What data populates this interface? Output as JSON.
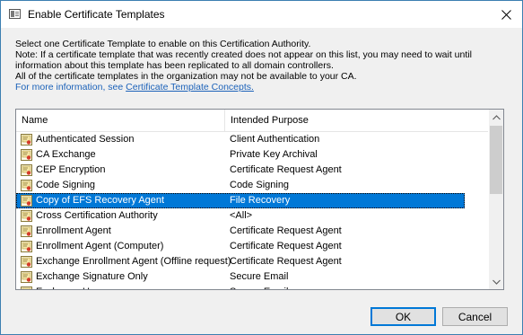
{
  "window": {
    "title": "Enable Certificate Templates"
  },
  "description": {
    "line1": "Select one Certificate Template to enable on this Certification Authority.",
    "line2": "Note: If a certificate template that was recently created does not appear on this list, you may need to wait until",
    "line3": "information about this template has been replicated to all domain controllers.",
    "line4": "All of the certificate templates in the organization may not be available to your CA.",
    "info_prefix": "For more information, see ",
    "info_link": "Certificate Template Concepts."
  },
  "list": {
    "columns": {
      "name": "Name",
      "purpose": "Intended Purpose"
    },
    "rows": [
      {
        "name": "Authenticated Session",
        "purpose": "Client Authentication",
        "selected": false
      },
      {
        "name": "CA Exchange",
        "purpose": "Private Key Archival",
        "selected": false
      },
      {
        "name": "CEP Encryption",
        "purpose": "Certificate Request Agent",
        "selected": false
      },
      {
        "name": "Code Signing",
        "purpose": "Code Signing",
        "selected": false
      },
      {
        "name": "Copy of EFS Recovery Agent",
        "purpose": "File Recovery",
        "selected": true
      },
      {
        "name": "Cross Certification Authority",
        "purpose": "<All>",
        "selected": false
      },
      {
        "name": "Enrollment Agent",
        "purpose": "Certificate Request Agent",
        "selected": false
      },
      {
        "name": "Enrollment Agent (Computer)",
        "purpose": "Certificate Request Agent",
        "selected": false
      },
      {
        "name": "Exchange Enrollment Agent (Offline request)",
        "purpose": "Certificate Request Agent",
        "selected": false
      },
      {
        "name": "Exchange Signature Only",
        "purpose": "Secure Email",
        "selected": false
      },
      {
        "name": "Exchange User",
        "purpose": "Secure Email",
        "selected": false
      }
    ],
    "row_icon": "certificate-template-icon"
  },
  "buttons": {
    "ok": "OK",
    "cancel": "Cancel"
  },
  "colors": {
    "selection": "#0078d7",
    "link": "#1c62b9",
    "border": "#3c7fb1"
  }
}
